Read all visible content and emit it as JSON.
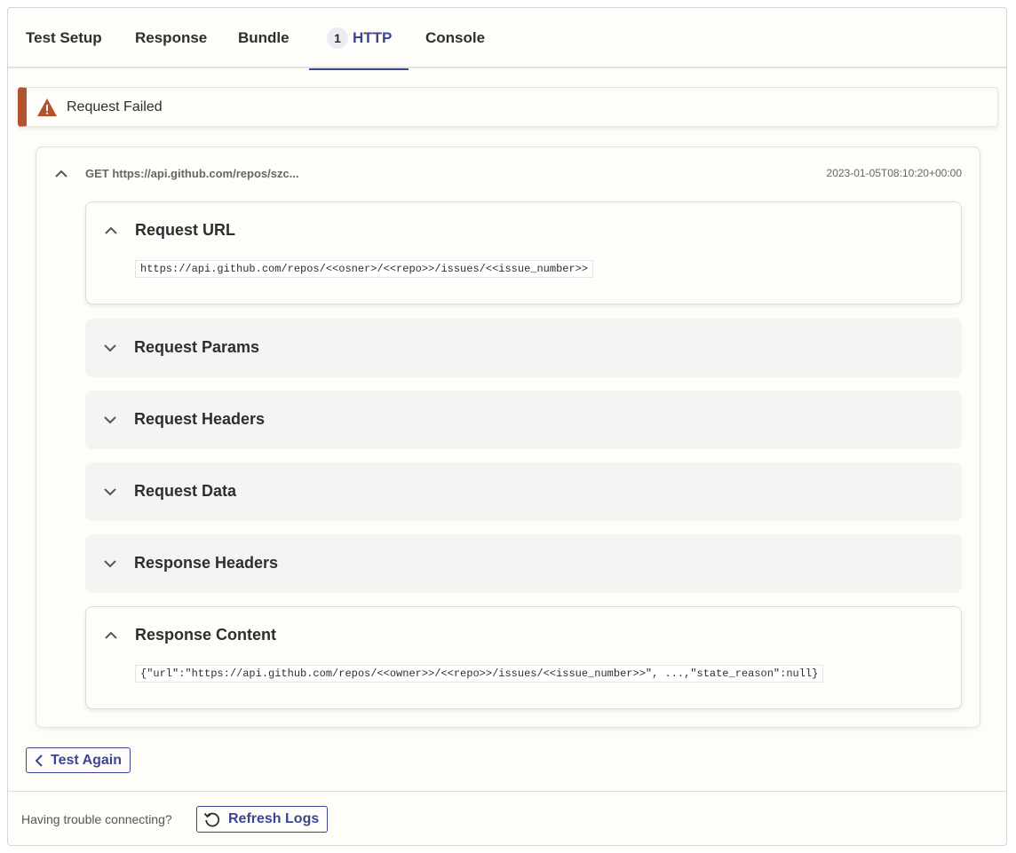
{
  "tabs": [
    {
      "label": "Test Setup"
    },
    {
      "label": "Response"
    },
    {
      "label": "Bundle"
    },
    {
      "label": "HTTP",
      "badge": "1",
      "active": true
    },
    {
      "label": "Console"
    }
  ],
  "alert": {
    "text": "Request Failed",
    "icon": "warning-triangle-icon",
    "accent_color": "#b1532c"
  },
  "log": {
    "title": "GET https://api.github.com/repos/szc...",
    "timestamp": "2023-01-05T08:10:20+00:00",
    "sections": [
      {
        "title": "Request URL",
        "expanded": true,
        "content": "https://api.github.com/repos/<<osner>/<<repo>>/issues/<<issue_number>>"
      },
      {
        "title": "Request Params",
        "expanded": false
      },
      {
        "title": "Request Headers",
        "expanded": false
      },
      {
        "title": "Request Data",
        "expanded": false
      },
      {
        "title": "Response Headers",
        "expanded": false
      },
      {
        "title": "Response Content",
        "expanded": true,
        "content": "{\"url\":\"https://api.github.com/repos/<<owner>>/<<repo>>/issues/<<issue_number>>\", ...,\"state_reason\":null}"
      }
    ]
  },
  "actions": {
    "test_again": "Test Again"
  },
  "footer": {
    "help_text": "Having trouble connecting?",
    "refresh_label": "Refresh Logs"
  },
  "colors": {
    "brand": "#3d4592",
    "background": "#fffdf9",
    "section_bg": "#f5f4f2"
  }
}
